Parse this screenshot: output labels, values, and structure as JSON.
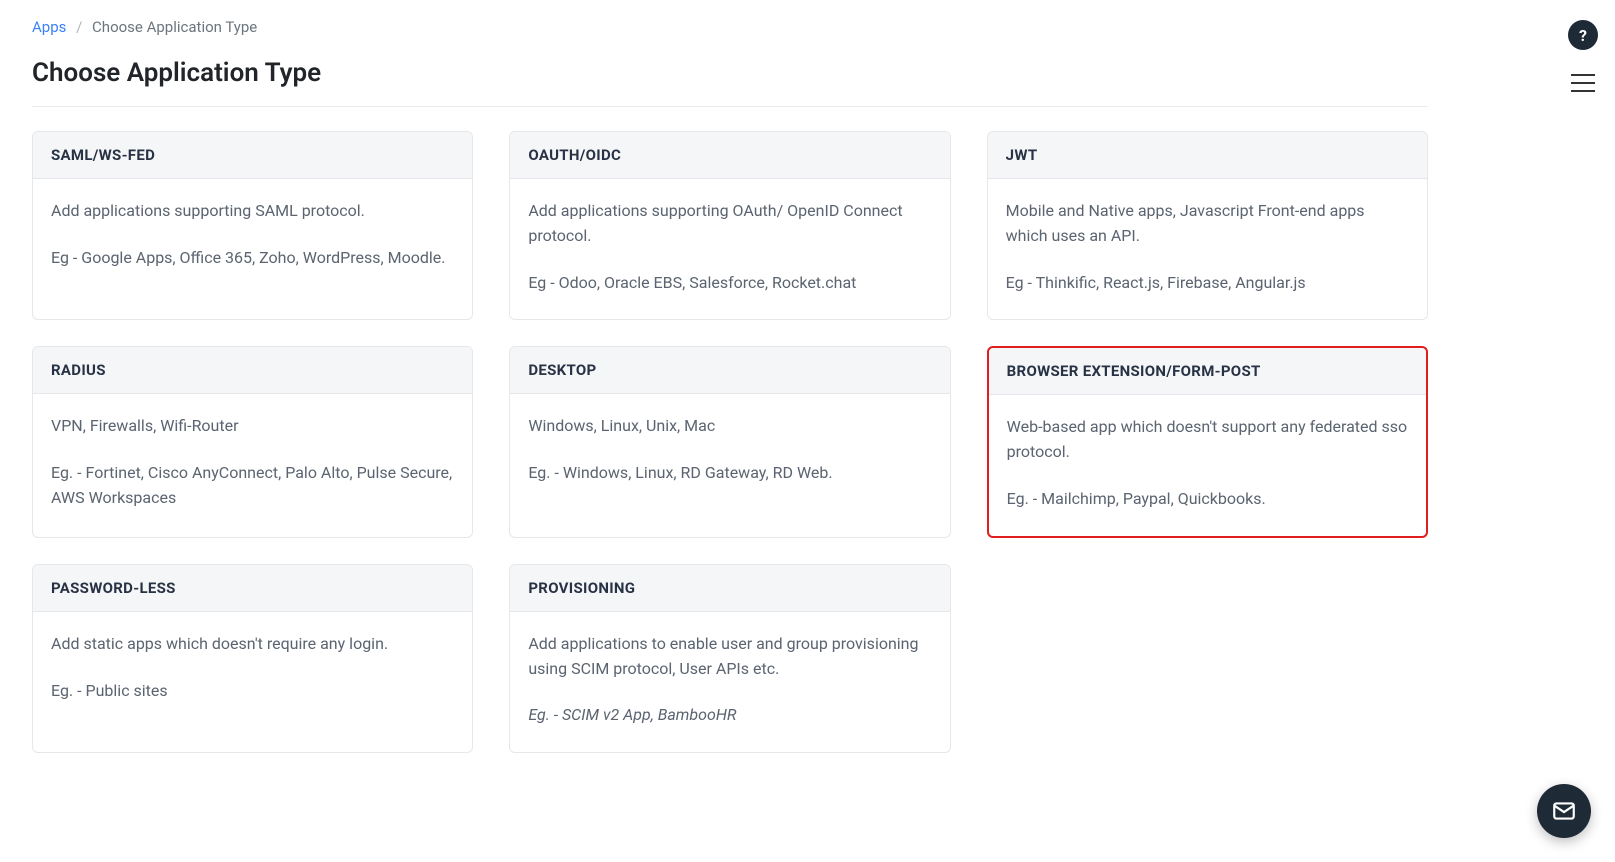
{
  "breadcrumb": {
    "root": "Apps",
    "current": "Choose Application Type"
  },
  "page_title": "Choose Application Type",
  "highlight_index": 5,
  "cards": [
    {
      "title": "SAML/WS-FED",
      "desc": "Add applications supporting SAML protocol.",
      "example": "Eg - Google Apps, Office 365, Zoho, WordPress, Moodle."
    },
    {
      "title": "OAUTH/OIDC",
      "desc": "Add applications supporting OAuth/ OpenID Connect protocol.",
      "example": "Eg - Odoo, Oracle EBS, Salesforce, Rocket.chat"
    },
    {
      "title": "JWT",
      "desc": "Mobile and Native apps, Javascript Front-end apps which uses an API.",
      "example": "Eg - Thinkific, React.js, Firebase, Angular.js"
    },
    {
      "title": "RADIUS",
      "desc": "VPN, Firewalls, Wifi-Router",
      "example": "Eg. - Fortinet, Cisco AnyConnect, Palo Alto, Pulse Secure, AWS Workspaces"
    },
    {
      "title": "DESKTOP",
      "desc": "Windows, Linux, Unix, Mac",
      "example": "Eg. - Windows, Linux, RD Gateway, RD Web."
    },
    {
      "title": "BROWSER EXTENSION/FORM-POST",
      "desc": "Web-based app which doesn't support any federated sso protocol.",
      "example": "Eg. - Mailchimp, Paypal, Quickbooks."
    },
    {
      "title": "PASSWORD-LESS",
      "desc": "Add static apps which doesn't require any login.",
      "example": "Eg. - Public sites"
    },
    {
      "title": "PROVISIONING",
      "desc": "Add applications to enable user and group provisioning using SCIM protocol, User APIs etc.",
      "example": "Eg. - SCIM v2 App, BambooHR",
      "example_italic": true
    }
  ],
  "rail": {
    "help": "?",
    "menu": "menu"
  }
}
